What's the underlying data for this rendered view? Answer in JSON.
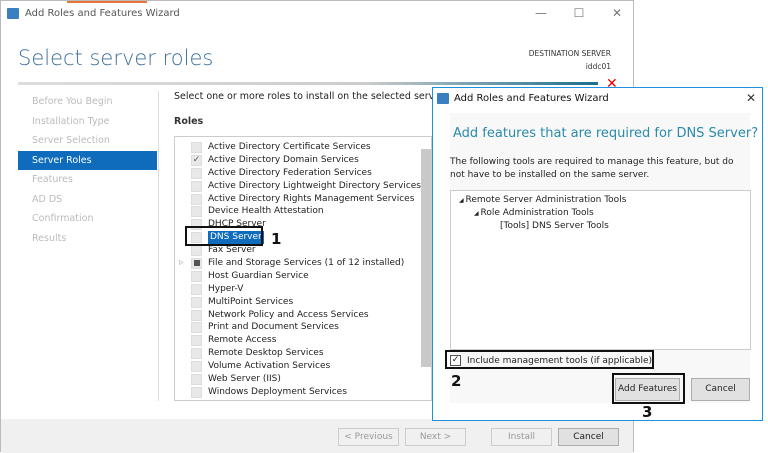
{
  "main": {
    "title": "Add Roles and Features Wizard",
    "heading": "Select server roles",
    "destination_label": "DESTINATION SERVER",
    "destination_server": "iddc01",
    "sidebar": [
      {
        "label": "Before You Begin"
      },
      {
        "label": "Installation Type"
      },
      {
        "label": "Server Selection"
      },
      {
        "label": "Server Roles",
        "selected": true
      },
      {
        "label": "Features"
      },
      {
        "label": "AD DS"
      },
      {
        "label": "Confirmation"
      },
      {
        "label": "Results"
      }
    ],
    "instruction": "Select one or more roles to install on the selected server.",
    "roles_label": "Roles",
    "roles": [
      {
        "label": "Active Directory Certificate Services"
      },
      {
        "label": "Active Directory Domain Services",
        "checked": true
      },
      {
        "label": "Active Directory Federation Services"
      },
      {
        "label": "Active Directory Lightweight Directory Services"
      },
      {
        "label": "Active Directory Rights Management Services"
      },
      {
        "label": "Device Health Attestation"
      },
      {
        "label": "DHCP Server"
      },
      {
        "label": "DNS Server",
        "selected": true
      },
      {
        "label": "Fax Server"
      },
      {
        "label": "File and Storage Services (1 of 12 installed)",
        "partial": true,
        "expandable": true
      },
      {
        "label": "Host Guardian Service"
      },
      {
        "label": "Hyper-V"
      },
      {
        "label": "MultiPoint Services"
      },
      {
        "label": "Network Policy and Access Services"
      },
      {
        "label": "Print and Document Services"
      },
      {
        "label": "Remote Access"
      },
      {
        "label": "Remote Desktop Services"
      },
      {
        "label": "Volume Activation Services"
      },
      {
        "label": "Web Server (IIS)"
      },
      {
        "label": "Windows Deployment Services"
      }
    ],
    "buttons": {
      "previous": "< Previous",
      "next": "Next >",
      "install": "Install",
      "cancel": "Cancel"
    }
  },
  "dialog": {
    "title": "Add Roles and Features Wizard",
    "heading": "Add features that are required for DNS Server?",
    "description": "The following tools are required to manage this feature, but do not have to be installed on the same server.",
    "tree": [
      "Remote Server Administration Tools",
      "Role Administration Tools",
      "[Tools] DNS Server Tools"
    ],
    "include_tools_label": "Include management tools (if applicable)",
    "include_tools_checked": true,
    "add_features": "Add Features",
    "cancel": "Cancel"
  },
  "annotations": {
    "step1": "1",
    "step2": "2",
    "step3": "3"
  },
  "colors": {
    "accent": "#0f6cbd",
    "heading": "#2a8bab",
    "error": "#e00000"
  }
}
